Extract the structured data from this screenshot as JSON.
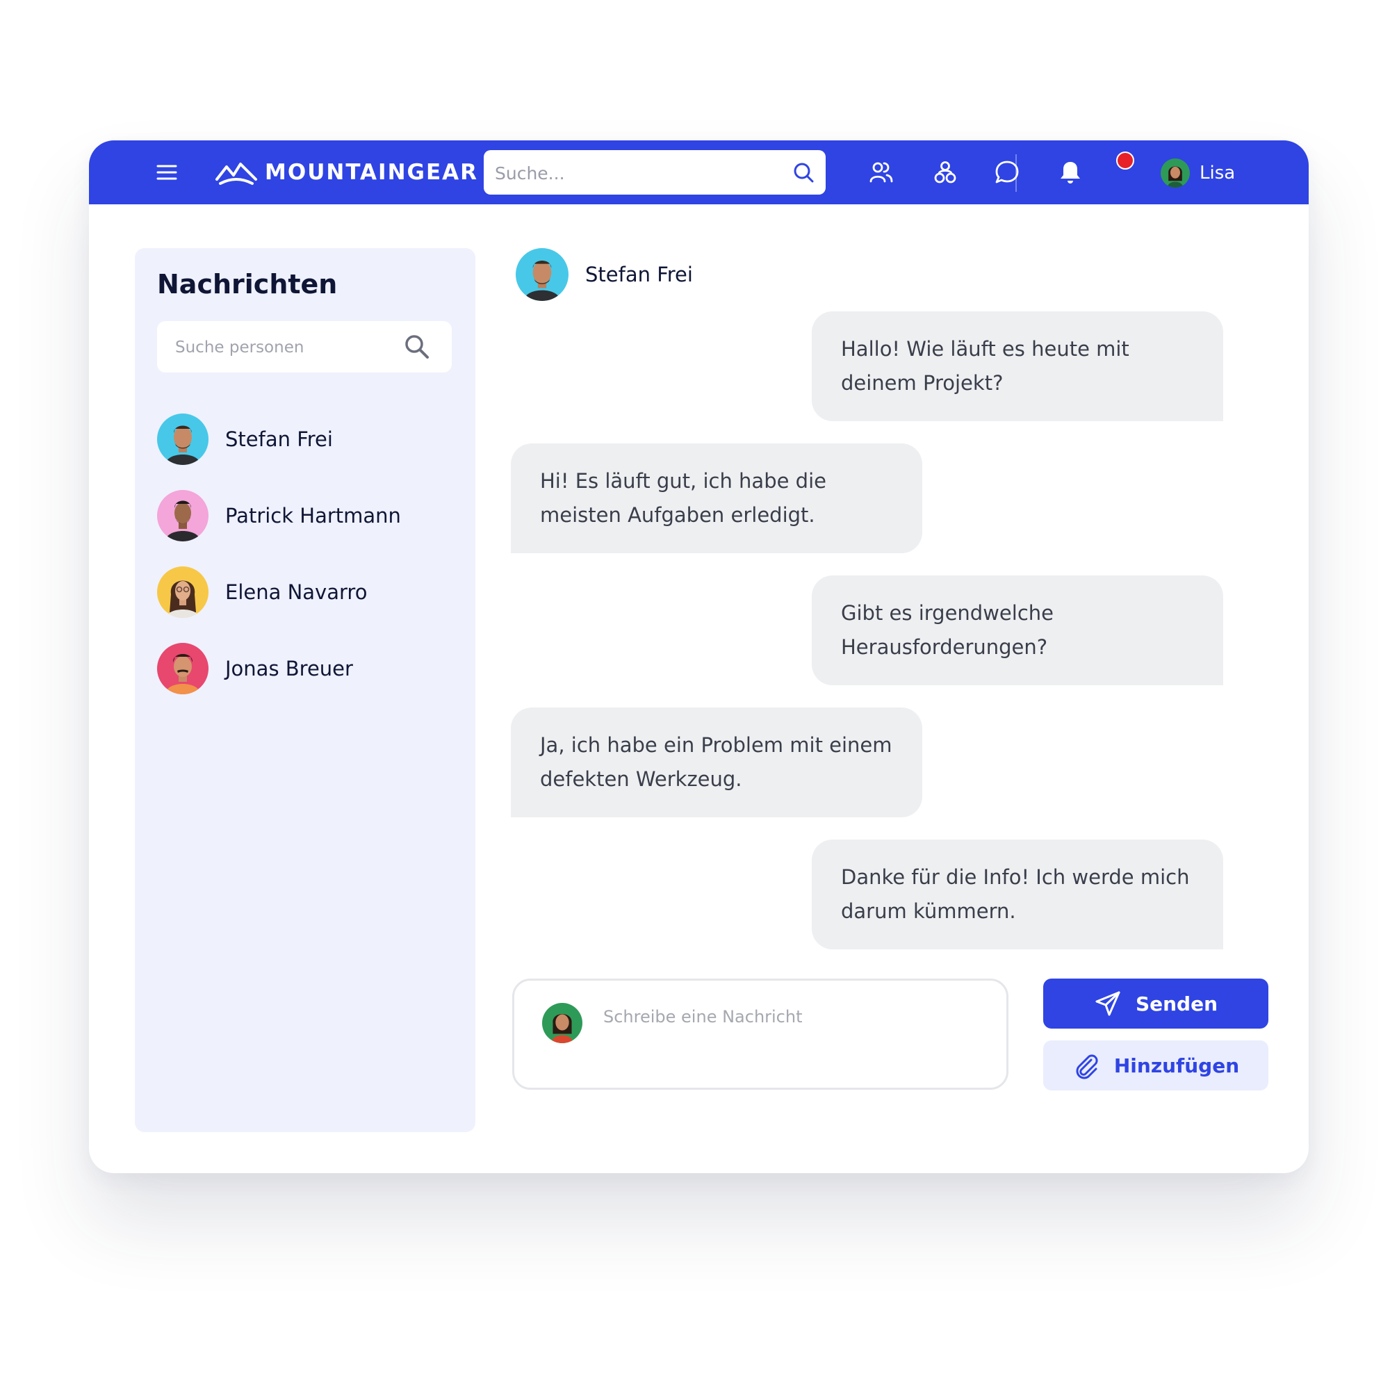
{
  "app": {
    "brand": "MOUNTAINGEAR",
    "search_placeholder": "Suche...",
    "user_name": "Lisa",
    "accent_color": "#2f44e3",
    "notification_color": "#e8202a",
    "nav_icons": [
      "menu-icon",
      "people-icon",
      "groups-icon",
      "chat-icon",
      "bell-icon"
    ]
  },
  "sidebar": {
    "title": "Nachrichten",
    "search_placeholder": "Suche personen",
    "contacts": [
      {
        "name": "Stefan Frei"
      },
      {
        "name": "Patrick Hartmann"
      },
      {
        "name": "Elena Navarro"
      },
      {
        "name": "Jonas Breuer"
      }
    ]
  },
  "chat": {
    "partner_name": "Stefan Frei",
    "messages": [
      {
        "direction": "outgoing",
        "text": "Hallo! Wie läuft es heute mit deinem Projekt?"
      },
      {
        "direction": "incoming",
        "text": "Hi! Es läuft gut, ich habe die meisten Aufgaben erledigt."
      },
      {
        "direction": "outgoing",
        "text": "Gibt es irgendwelche Herausforderungen?"
      },
      {
        "direction": "incoming",
        "text": "Ja, ich habe ein Problem mit einem defekten Werkzeug."
      },
      {
        "direction": "outgoing",
        "text": "Danke für die Info! Ich werde mich darum kümmern."
      }
    ],
    "compose_placeholder": "Schreibe eine Nachricht",
    "send_label": "Senden",
    "attach_label": "Hinzufügen"
  }
}
